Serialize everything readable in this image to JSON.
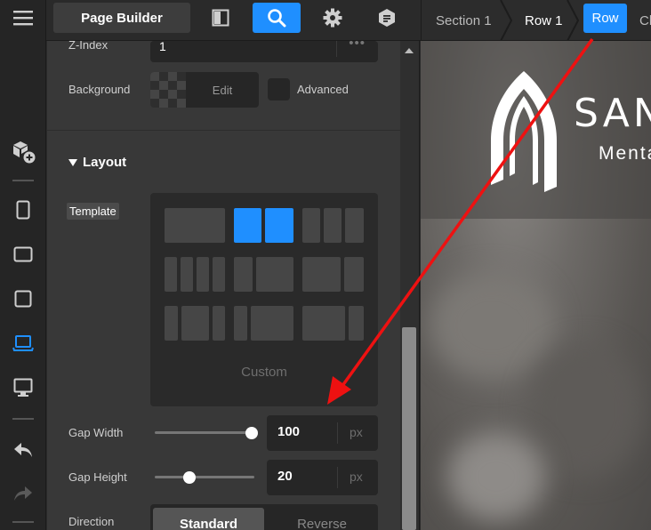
{
  "topbar": {
    "page_builder_label": "Page Builder"
  },
  "breadcrumbs": {
    "section": "Section 1",
    "row": "Row 1",
    "active_pill": "Row",
    "overflow_text": "Ch"
  },
  "panel": {
    "zindex_label": "Z-Index",
    "zindex_value": "1",
    "zindex_more": "•••",
    "background_label": "Background",
    "background_edit": "Edit",
    "advanced_label": "Advanced",
    "layout_heading": "Layout",
    "template_label": "Template",
    "custom_label": "Custom",
    "gap_width_label": "Gap Width",
    "gap_width_value": "100",
    "gap_width_unit": "px",
    "gap_width_fraction": 0.97,
    "gap_height_label": "Gap Height",
    "gap_height_value": "20",
    "gap_height_unit": "px",
    "gap_height_fraction": 0.35,
    "direction_label": "Direction",
    "direction_options": [
      "Standard",
      "Reverse"
    ],
    "direction_selected": "Standard"
  },
  "preview": {
    "brand_text": "SAN",
    "tagline_text": "Menta"
  },
  "colors": {
    "accent": "#1f8fff",
    "annotation_arrow": "#ee1111"
  }
}
